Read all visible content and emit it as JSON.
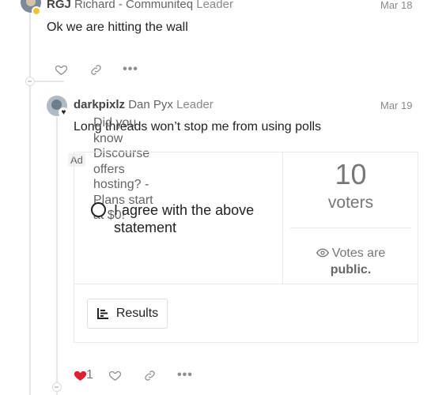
{
  "post1": {
    "username": "RGJ",
    "full_name": "Richard - Communiteq",
    "title": "Leader",
    "date": "Mar 18",
    "body": "Ok we are hitting the wall",
    "actions": {
      "like": "heart-icon",
      "link": "link-icon",
      "more": "•••"
    }
  },
  "post2": {
    "username": "darkpixlz",
    "full_name": "Dan Pyx",
    "title": "Leader",
    "date": "Mar 19",
    "body": "Long threads won’t stop me from using polls",
    "ad": {
      "label": "Ad",
      "text": "Did you know Discourse offers hosting? - Plans start at $0!"
    },
    "poll": {
      "option": "I agree with the above statement",
      "voters_count": "10",
      "voters_label": "voters",
      "visibility_prefix": "Votes are",
      "visibility_value": "public.",
      "results_button": "Results"
    },
    "actions": {
      "like_count": "1",
      "liked_color": "#e0202e",
      "more": "•••"
    }
  }
}
